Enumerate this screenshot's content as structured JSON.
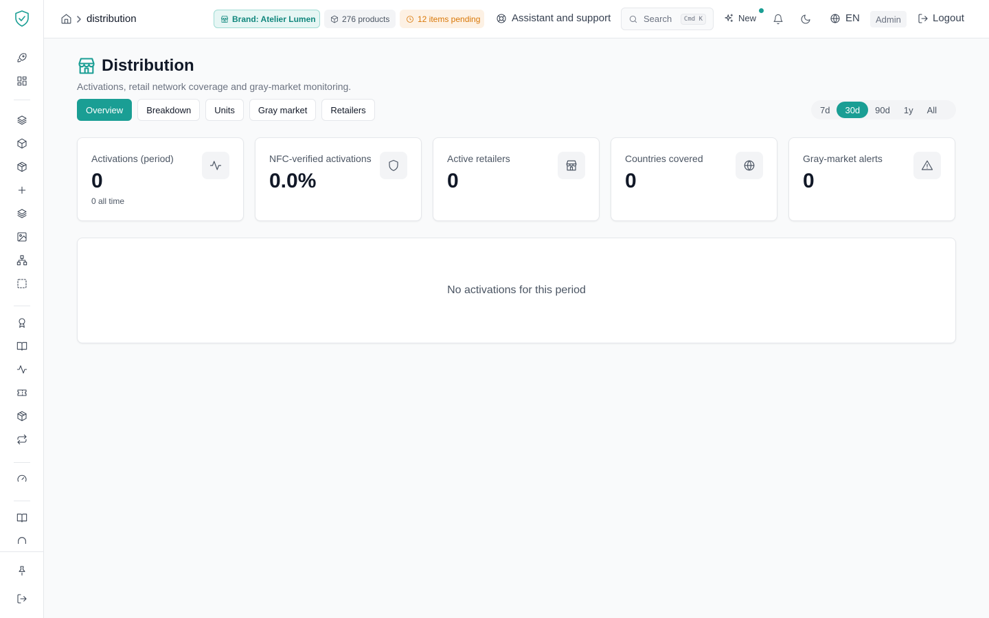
{
  "colors": {
    "accent": "#1a9e94",
    "warning": "#d97706"
  },
  "sidebar": {
    "logo_icon": "shield-check-icon",
    "items": [
      {
        "icon": "rocket-icon"
      },
      {
        "icon": "dashboard-icon"
      },
      {
        "icon": "layers-icon"
      },
      {
        "icon": "box-icon"
      },
      {
        "icon": "package-icon"
      },
      {
        "icon": "plus-icon"
      },
      {
        "icon": "layers-icon"
      },
      {
        "icon": "image-icon"
      },
      {
        "icon": "hierarchy-icon"
      },
      {
        "icon": "dashed-square-icon"
      },
      {
        "icon": "award-icon"
      },
      {
        "icon": "book-icon"
      },
      {
        "icon": "activity-icon"
      },
      {
        "icon": "ticket-icon"
      },
      {
        "icon": "package-icon"
      },
      {
        "icon": "repeat-icon"
      },
      {
        "icon": "gauge-icon"
      },
      {
        "icon": "book-icon"
      },
      {
        "icon": "arch-icon"
      }
    ],
    "bottom": [
      {
        "icon": "pin-icon"
      },
      {
        "icon": "logout-icon"
      }
    ]
  },
  "topbar": {
    "breadcrumb": {
      "home_icon": "home-icon",
      "current": "distribution"
    },
    "brand_pill": "Brand: Atelier Lumen",
    "products_pill": "276 products",
    "pending_pill": "12 items pending",
    "assistant_label": "Assistant and support",
    "search": {
      "placeholder": "Search",
      "shortcut": "Cmd K"
    },
    "new_label": "New",
    "language": "EN",
    "role": "Admin",
    "logout_label": "Logout"
  },
  "page": {
    "title": "Distribution",
    "subtitle": "Activations, retail network coverage and gray-market monitoring.",
    "tabs": [
      {
        "label": "Overview",
        "active": true
      },
      {
        "label": "Breakdown"
      },
      {
        "label": "Units"
      },
      {
        "label": "Gray market"
      },
      {
        "label": "Retailers"
      }
    ],
    "periods": [
      {
        "label": "7d"
      },
      {
        "label": "30d",
        "active": true
      },
      {
        "label": "90d"
      },
      {
        "label": "1y"
      },
      {
        "label": "All"
      }
    ]
  },
  "stats": [
    {
      "label": "Activations (period)",
      "value": "0",
      "sub": "0 all time",
      "icon": "activity-icon"
    },
    {
      "label": "NFC-verified activations",
      "value": "0.0%",
      "sub": "",
      "icon": "shield-icon"
    },
    {
      "label": "Active retailers",
      "value": "0",
      "sub": "",
      "icon": "store-icon"
    },
    {
      "label": "Countries covered",
      "value": "0",
      "sub": "",
      "icon": "globe-icon"
    },
    {
      "label": "Gray-market alerts",
      "value": "0",
      "sub": "",
      "icon": "alert-triangle-icon"
    }
  ],
  "empty_state": "No activations for this period"
}
